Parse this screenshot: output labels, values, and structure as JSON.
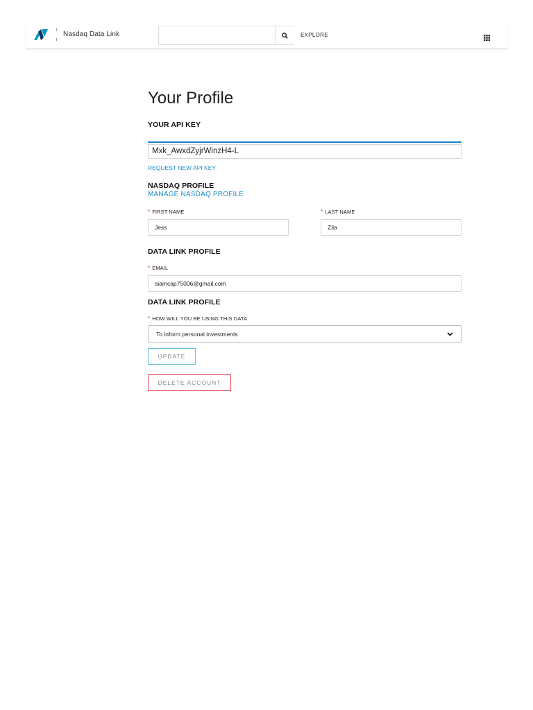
{
  "header": {
    "logo_icon": "nasdaq-logo-icon",
    "brand_name": "Nasdaq Data Link",
    "search_placeholder": "",
    "search_icon": "search-icon",
    "explore_label": "EXPLORE",
    "apps_icon": "grid-icon"
  },
  "profile": {
    "title": "Your Profile",
    "api_key_heading": "YOUR API KEY",
    "api_key_value": "Mxk_AwxdZyjrWinzH4-L",
    "request_new_key_link": "REQUEST NEW API KEY",
    "nasdaq_profile_heading": "NASDAQ PROFILE",
    "manage_nasdaq_profile_link": "MANAGE NASDAQ PROFILE",
    "first_name_label": "FIRST NAME",
    "first_name_value": "Jess",
    "last_name_label": "LAST NAME",
    "last_name_value": "Zila",
    "data_link_profile_heading": "DATA LINK PROFILE",
    "email_label": "EMAIL",
    "email_value": "siamcap75006@gmail.com",
    "data_link_profile_heading_2": "DATA LINK PROFILE",
    "usage_label": "HOW WILL YOU BE USING THIS DATA",
    "usage_selected": "To inform personal investments",
    "required_marker": "*",
    "update_label": "UPDATE",
    "delete_label": "DELETE ACCOUNT"
  },
  "colors": {
    "accent": "#1d8ec7",
    "api_bar": "#1d7fbf",
    "required": "#c2208f",
    "update_border": "#6fc0e3",
    "delete_border": "#e64a5f"
  }
}
